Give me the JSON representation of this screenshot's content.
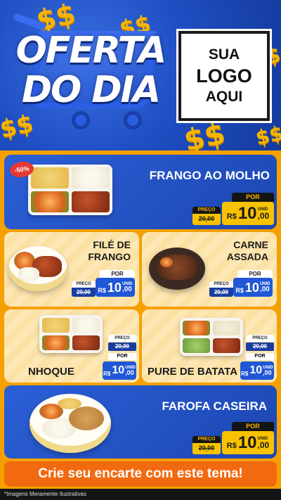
{
  "header": {
    "title_line1": "OFERTA",
    "title_line2": "DO DIA",
    "logo_line1": "SUA",
    "logo_line2": "LOGO",
    "logo_line3": "AQUI",
    "coin_glyph": "$$"
  },
  "price_labels": {
    "preco": "PREÇO",
    "por": "POR",
    "currency": "R$",
    "unid": "UNID"
  },
  "products": [
    {
      "name": "FRANGO AO MOLHO",
      "badge": "-50%",
      "old_price": "20,00",
      "new_int": "10",
      "new_dec": ",00"
    },
    {
      "name_line1": "FILÉ DE",
      "name_line2": "FRANGO",
      "old_price": "20,00",
      "new_int": "10",
      "new_dec": ",00"
    },
    {
      "name_line1": "CARNE",
      "name_line2": "ASSADA",
      "old_price": "20,00",
      "new_int": "10",
      "new_dec": ",00"
    },
    {
      "name": "NHOQUE",
      "old_price": "20,00",
      "new_int": "10",
      "new_dec": ",00"
    },
    {
      "name": "PURE DE BATATA",
      "old_price": "20,00",
      "new_int": "10",
      "new_dec": ",00"
    },
    {
      "name": "FAROFA CASEIRA",
      "old_price": "20,00",
      "new_int": "10",
      "new_dec": ",00"
    }
  ],
  "cta": "Crie seu encarte com este tema!",
  "footer": "*Imagens Meramente Ilustrativas",
  "colors": {
    "brand_blue": "#1f4fc4",
    "brand_orange": "#f6a000",
    "cta_orange": "#f26a10",
    "price_yellow": "#f7c200"
  }
}
